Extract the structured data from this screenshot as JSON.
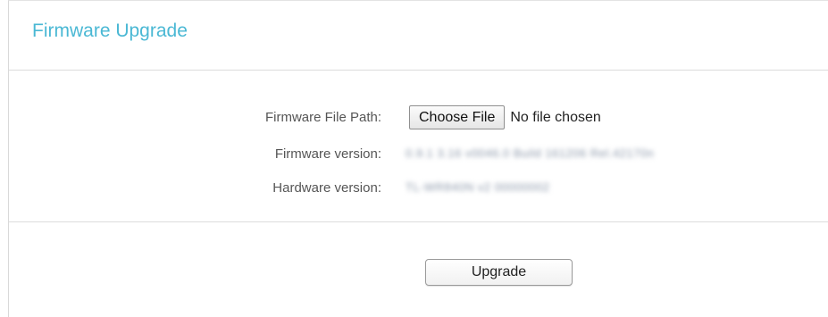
{
  "page": {
    "title": "Firmware Upgrade"
  },
  "form": {
    "file_path_label": "Firmware File Path:",
    "choose_file_label": "Choose File",
    "no_file_text": "No file chosen",
    "firmware_version_label": "Firmware version:",
    "firmware_version_value": "0.9.1 3.16 v0046.0 Build 161206 Rel.42170n",
    "hardware_version_label": "Hardware version:",
    "hardware_version_value": "TL-WR840N v2 00000002",
    "upgrade_button_label": "Upgrade"
  },
  "colors": {
    "title_accent": "#4ab8d4",
    "divider": "#dcdcdc"
  }
}
